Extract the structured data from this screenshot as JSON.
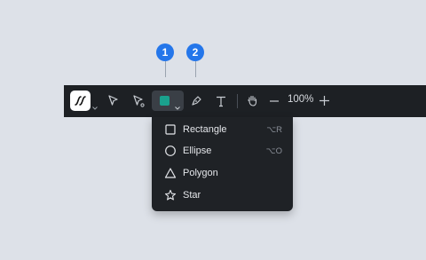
{
  "callouts": [
    "1",
    "2"
  ],
  "toolbar": {
    "logo_icon": "app-logo-icon",
    "tools": [
      "select-arrow-icon",
      "direct-select-icon",
      "shape-fill-tool",
      "pen-tool-icon",
      "text-tool-icon",
      "hand-tool-icon"
    ],
    "fill_color": "#1aa18d",
    "zoom_label": "100%",
    "zoom_out_icon": "minus-icon",
    "zoom_in_icon": "plus-icon"
  },
  "shape_menu": {
    "items": [
      {
        "label": "Rectangle",
        "shortcut": "⌥R",
        "icon": "square-icon"
      },
      {
        "label": "Ellipse",
        "shortcut": "⌥O",
        "icon": "circle-icon"
      },
      {
        "label": "Polygon",
        "shortcut": "",
        "icon": "triangle-icon"
      },
      {
        "label": "Star",
        "shortcut": "",
        "icon": "star-icon"
      }
    ]
  },
  "colors": {
    "background": "#dde1e8",
    "toolbar": "#1d2024",
    "callout": "#2476ea",
    "accent_fill": "#1aa18d"
  }
}
